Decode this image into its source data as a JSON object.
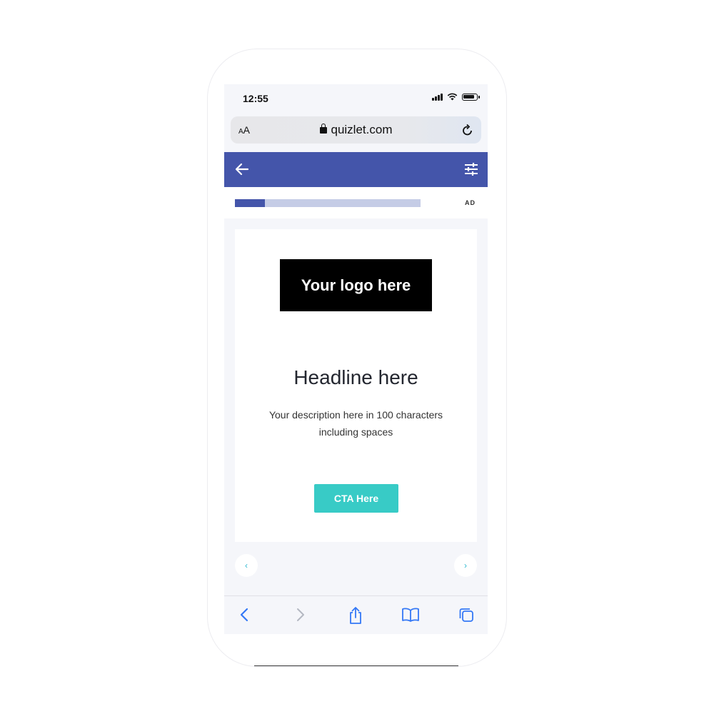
{
  "status_bar": {
    "time": "12:55"
  },
  "url_bar": {
    "text_size_small": "A",
    "text_size_large": "A",
    "domain": "quizlet.com"
  },
  "progress": {
    "fraction": 0.16
  },
  "ad": {
    "label": "AD",
    "logo_text": "Your logo here",
    "headline": "Headline here",
    "description": "Your description here in 100 characters including spaces",
    "cta_label": "CTA Here",
    "prev_glyph": "‹",
    "next_glyph": "›"
  },
  "colors": {
    "header": "#4455aa",
    "progress_fill": "#4455aa",
    "progress_track": "#c5cce6",
    "cta": "#38cbc6",
    "toolbar_icon": "#3478f6"
  },
  "icons": {
    "header_left": "arrow-left-icon",
    "header_right": "filter-sliders-icon",
    "toolbar": [
      "back-icon",
      "forward-icon",
      "share-icon",
      "bookmarks-icon",
      "tabs-icon"
    ]
  }
}
